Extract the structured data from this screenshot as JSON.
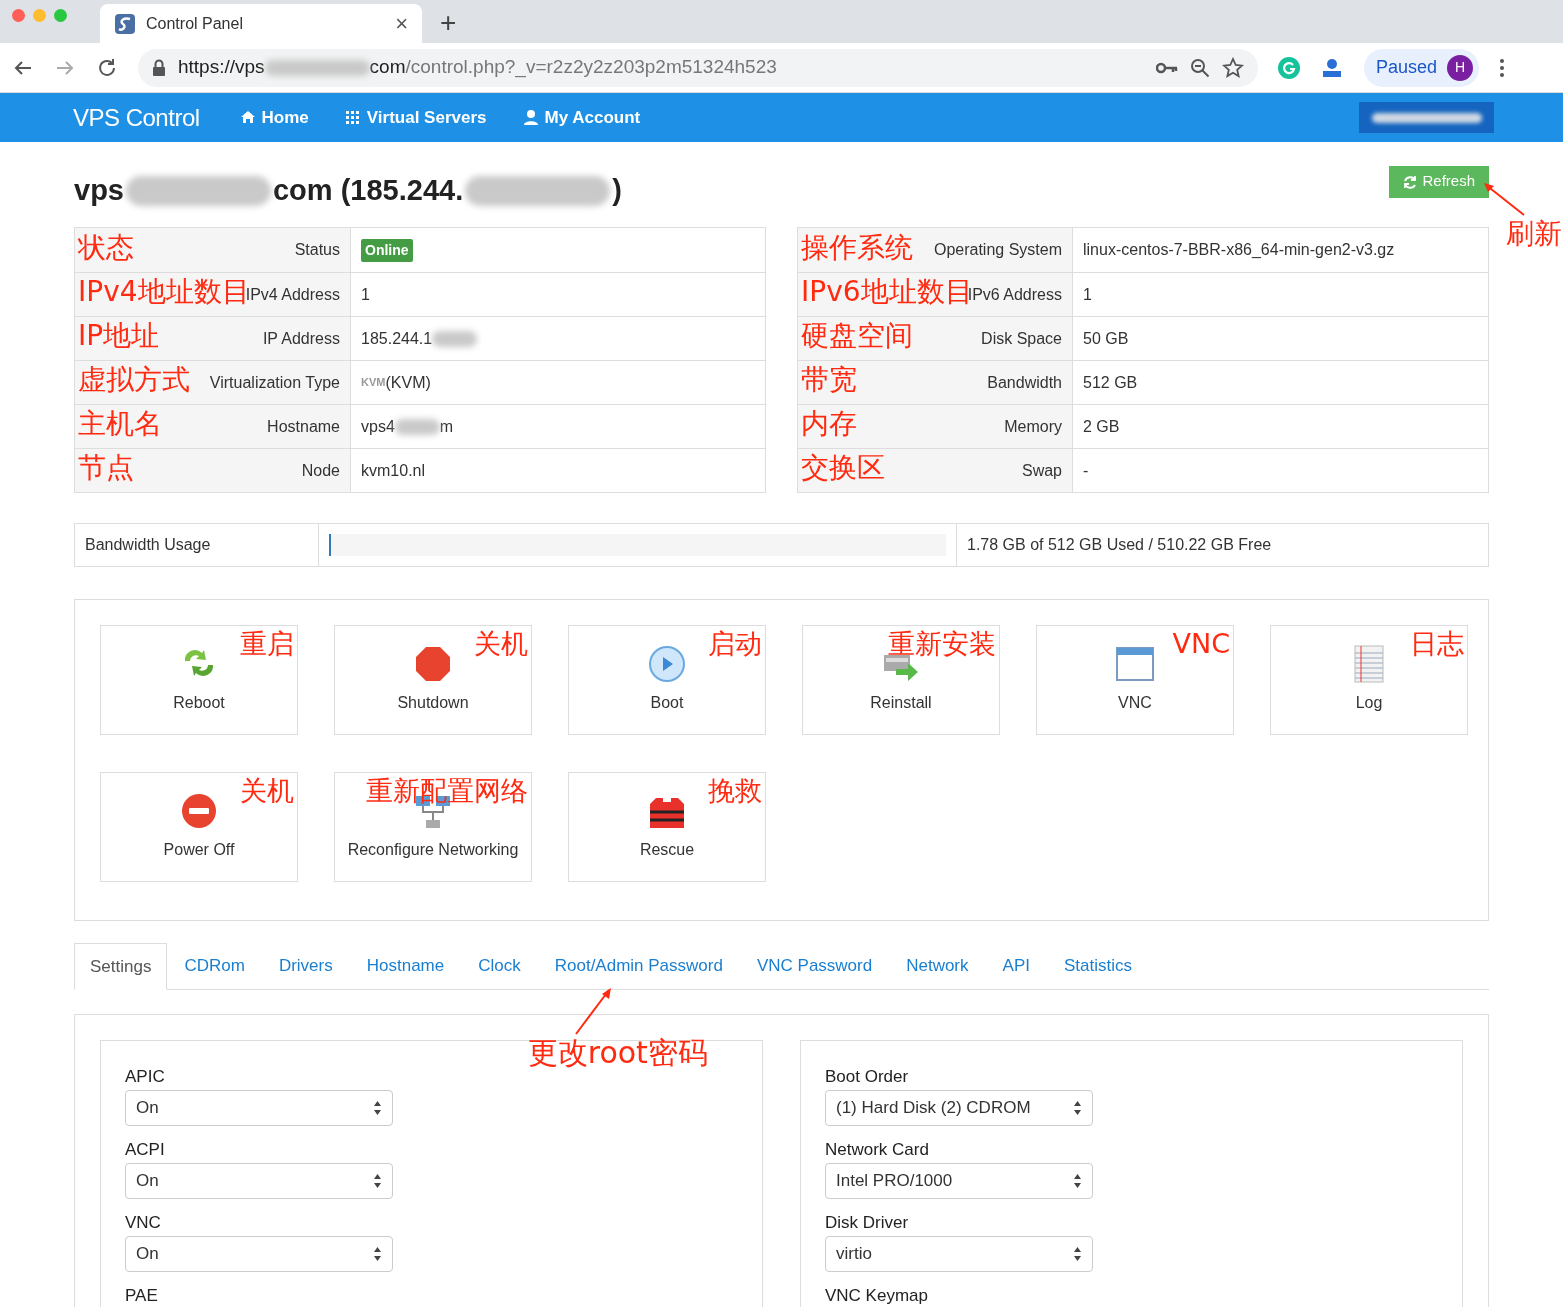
{
  "browser": {
    "tab_title": "Control Panel",
    "close": "×",
    "new_tab": "+",
    "url": [
      {
        "kind": "text",
        "text": "https://vps"
      },
      {
        "kind": "blur"
      },
      {
        "kind": "text",
        "text": "com"
      },
      {
        "kind": "dim",
        "text": "/control.php?_v=r2z2y2z203p2m51324h523"
      }
    ],
    "profile": "Paused",
    "avatar": "H"
  },
  "navbar": {
    "brand": "VPS Control",
    "links": [
      {
        "label": "Home"
      },
      {
        "label": "Virtual Servers"
      },
      {
        "label": "My Account"
      }
    ]
  },
  "title": [
    {
      "kind": "text",
      "text": "vps"
    },
    {
      "kind": "blur"
    },
    {
      "kind": "text",
      "text": "com (185.244."
    },
    {
      "kind": "blur"
    },
    {
      "kind": "text",
      "text": ")"
    }
  ],
  "refresh": {
    "label": "Refresh",
    "annotation": "刷新"
  },
  "left_table": [
    {
      "label": "Status",
      "annotation": "状态",
      "value": [
        {
          "kind": "badge",
          "text": "Online"
        }
      ]
    },
    {
      "label": "IPv4 Address",
      "annotation": "IPv4地址数目",
      "value": [
        {
          "kind": "text",
          "text": "1"
        }
      ]
    },
    {
      "label": "IP Address",
      "annotation": "IP地址",
      "value": [
        {
          "kind": "text",
          "text": "185.244.1"
        },
        {
          "kind": "blur"
        }
      ]
    },
    {
      "label": "Virtualization Type",
      "annotation": "虚拟方式",
      "value": [
        {
          "kind": "logo",
          "text": "KVM"
        },
        {
          "kind": "text",
          "text": "(KVM)"
        }
      ]
    },
    {
      "label": "Hostname",
      "annotation": "主机名",
      "value": [
        {
          "kind": "text",
          "text": "vps4"
        },
        {
          "kind": "blur"
        },
        {
          "kind": "text",
          "text": "m"
        }
      ]
    },
    {
      "label": "Node",
      "annotation": "节点",
      "value": [
        {
          "kind": "text",
          "text": "kvm10.nl"
        }
      ]
    }
  ],
  "right_table": [
    {
      "label": "Operating System",
      "annotation": "操作系统",
      "value": [
        {
          "kind": "text",
          "text": "linux-centos-7-BBR-x86_64-min-gen2-v3.gz"
        }
      ]
    },
    {
      "label": "IPv6 Address",
      "annotation": "IPv6地址数目",
      "value": [
        {
          "kind": "text",
          "text": "1"
        }
      ]
    },
    {
      "label": "Disk Space",
      "annotation": "硬盘空间",
      "value": [
        {
          "kind": "text",
          "text": "50 GB"
        }
      ]
    },
    {
      "label": "Bandwidth",
      "annotation": "带宽",
      "value": [
        {
          "kind": "text",
          "text": "512 GB"
        }
      ]
    },
    {
      "label": "Memory",
      "annotation": "内存",
      "value": [
        {
          "kind": "text",
          "text": "2 GB"
        }
      ]
    },
    {
      "label": "Swap",
      "annotation": "交换区",
      "value": [
        {
          "kind": "text",
          "text": "-"
        }
      ]
    }
  ],
  "bandwidth": {
    "label": "Bandwidth Usage",
    "level": 0.0035,
    "reading": "1.78 GB of 512 GB Used / 510.22 GB Free"
  },
  "actions": [
    {
      "label": "Reboot",
      "annotation": "重启"
    },
    {
      "label": "Shutdown",
      "annotation": "关机"
    },
    {
      "label": "Boot",
      "annotation": "启动"
    },
    {
      "label": "Reinstall",
      "annotation": "重新安装"
    },
    {
      "label": "VNC",
      "annotation": "VNC"
    },
    {
      "label": "Log",
      "annotation": "日志"
    },
    {
      "label": "Power Off",
      "annotation": "关机"
    },
    {
      "label": "Reconfigure Networking",
      "annotation": "重新配置网络"
    },
    {
      "label": "Rescue",
      "annotation": "挽救"
    }
  ],
  "tabs": [
    {
      "label": "Settings",
      "selected": true
    },
    {
      "label": "CDRom",
      "selected": false
    },
    {
      "label": "Drivers",
      "selected": false
    },
    {
      "label": "Hostname",
      "selected": false
    },
    {
      "label": "Clock",
      "selected": false
    },
    {
      "label": "Root/Admin Password",
      "selected": false,
      "annotation": "更改root密码"
    },
    {
      "label": "VNC Password",
      "selected": false
    },
    {
      "label": "Network",
      "selected": false
    },
    {
      "label": "API",
      "selected": false
    },
    {
      "label": "Statistics",
      "selected": false
    }
  ],
  "settings_left": [
    {
      "label": "APIC",
      "value": "On"
    },
    {
      "label": "ACPI",
      "value": "On"
    },
    {
      "label": "VNC",
      "value": "On"
    },
    {
      "label": "PAE"
    }
  ],
  "settings_right": [
    {
      "label": "Boot Order",
      "value": "(1) Hard Disk (2) CDROM"
    },
    {
      "label": "Network Card",
      "value": "Intel PRO/1000"
    },
    {
      "label": "Disk Driver",
      "value": "virtio"
    },
    {
      "label": "VNC Keymap"
    }
  ]
}
